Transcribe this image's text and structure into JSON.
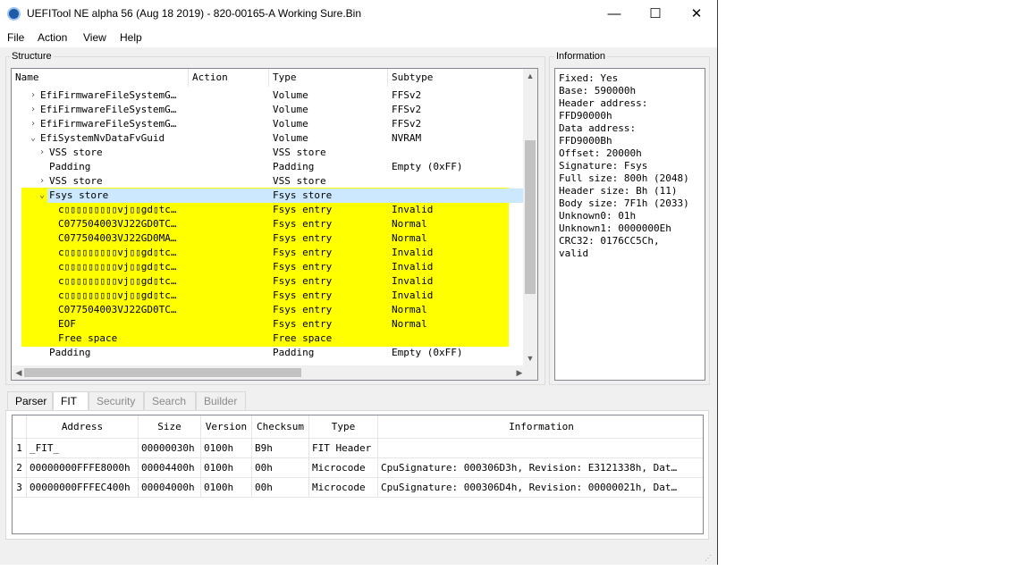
{
  "window": {
    "title": "UEFITool NE alpha 56 (Aug 18 2019) - 820-00165-A Working Sure.Bin",
    "minimize": "—",
    "maximize": "☐",
    "close": "✕"
  },
  "menu": [
    "File",
    "Action",
    "View",
    "Help"
  ],
  "structure": {
    "label": "Structure",
    "columns": [
      "Name",
      "Action",
      "Type",
      "Subtype"
    ],
    "rows": [
      {
        "indent": 1,
        "expander": "›",
        "name": "EfiFirmwareFileSystemG…",
        "action": "",
        "type": "Volume",
        "subtype": "FFSv2"
      },
      {
        "indent": 1,
        "expander": "›",
        "name": "EfiFirmwareFileSystemG…",
        "action": "",
        "type": "Volume",
        "subtype": "FFSv2"
      },
      {
        "indent": 1,
        "expander": "›",
        "name": "EfiFirmwareFileSystemG…",
        "action": "",
        "type": "Volume",
        "subtype": "FFSv2"
      },
      {
        "indent": 1,
        "expander": "⌄",
        "name": "EfiSystemNvDataFvGuid",
        "action": "",
        "type": "Volume",
        "subtype": "NVRAM"
      },
      {
        "indent": 2,
        "expander": "›",
        "name": "VSS store",
        "action": "",
        "type": "VSS store",
        "subtype": ""
      },
      {
        "indent": 2,
        "expander": "",
        "name": "Padding",
        "action": "",
        "type": "Padding",
        "subtype": "Empty (0xFF)"
      },
      {
        "indent": 2,
        "expander": "›",
        "name": "VSS store",
        "action": "",
        "type": "VSS store",
        "subtype": ""
      },
      {
        "indent": 2,
        "expander": "⌄",
        "name": "Fsys store",
        "action": "",
        "type": "Fsys store",
        "subtype": ""
      },
      {
        "indent": 3,
        "expander": "",
        "name": "c▯▯▯▯▯▯▯▯▯vj▯▯gd▯tc…",
        "action": "",
        "type": "Fsys entry",
        "subtype": "Invalid"
      },
      {
        "indent": 3,
        "expander": "",
        "name": "C077504003VJ22GD0TC…",
        "action": "",
        "type": "Fsys entry",
        "subtype": "Normal"
      },
      {
        "indent": 3,
        "expander": "",
        "name": "C077504003VJ22GD0MA…",
        "action": "",
        "type": "Fsys entry",
        "subtype": "Normal"
      },
      {
        "indent": 3,
        "expander": "",
        "name": "c▯▯▯▯▯▯▯▯▯vj▯▯gd▯tc…",
        "action": "",
        "type": "Fsys entry",
        "subtype": "Invalid"
      },
      {
        "indent": 3,
        "expander": "",
        "name": "c▯▯▯▯▯▯▯▯▯vj▯▯gd▯tc…",
        "action": "",
        "type": "Fsys entry",
        "subtype": "Invalid"
      },
      {
        "indent": 3,
        "expander": "",
        "name": "c▯▯▯▯▯▯▯▯▯vj▯▯gd▯tc…",
        "action": "",
        "type": "Fsys entry",
        "subtype": "Invalid"
      },
      {
        "indent": 3,
        "expander": "",
        "name": "c▯▯▯▯▯▯▯▯▯vj▯▯gd▯tc…",
        "action": "",
        "type": "Fsys entry",
        "subtype": "Invalid"
      },
      {
        "indent": 3,
        "expander": "",
        "name": "C077504003VJ22GD0TC…",
        "action": "",
        "type": "Fsys entry",
        "subtype": "Normal"
      },
      {
        "indent": 3,
        "expander": "",
        "name": "EOF",
        "action": "",
        "type": "Fsys entry",
        "subtype": "Normal"
      },
      {
        "indent": 3,
        "expander": "",
        "name": "Free space",
        "action": "",
        "type": "Free space",
        "subtype": ""
      },
      {
        "indent": 2,
        "expander": "",
        "name": "Padding",
        "action": "",
        "type": "Padding",
        "subtype": "Empty (0xFF)"
      }
    ],
    "highlight_color": "#ffff00",
    "selection_color": "#cce8ff"
  },
  "information": {
    "label": "Information",
    "lines": [
      "Fixed: Yes",
      "Base: 590000h",
      "Header address:",
      "FFD90000h",
      "Data address:",
      "FFD9000Bh",
      "Offset: 20000h",
      "Signature: Fsys",
      "Full size: 800h (2048)",
      "Header size: Bh (11)",
      "Body size: 7F1h (2033)",
      "Unknown0: 01h",
      "Unknown1: 0000000Eh",
      "CRC32: 0176CC5Ch,",
      "valid"
    ]
  },
  "tabs": [
    {
      "label": "Parser",
      "state": "normal"
    },
    {
      "label": "FIT",
      "state": "active"
    },
    {
      "label": "Security",
      "state": "disabled"
    },
    {
      "label": "Search",
      "state": "disabled"
    },
    {
      "label": "Builder",
      "state": "disabled"
    }
  ],
  "fit": {
    "columns": [
      "Address",
      "Size",
      "Version",
      "Checksum",
      "Type",
      "Information"
    ],
    "rows": [
      {
        "num": "1",
        "address": "_FIT_",
        "size": "00000030h",
        "version": "0100h",
        "checksum": "B9h",
        "type": "FIT Header",
        "information": ""
      },
      {
        "num": "2",
        "address": "00000000FFFE8000h",
        "size": "00004400h",
        "version": "0100h",
        "checksum": "00h",
        "type": "Microcode",
        "information": "CpuSignature: 000306D3h, Revision: E3121338h, Dat…"
      },
      {
        "num": "3",
        "address": "00000000FFFEC400h",
        "size": "00004000h",
        "version": "0100h",
        "checksum": "00h",
        "type": "Microcode",
        "information": "CpuSignature: 000306D4h, Revision: 00000021h, Dat…"
      }
    ]
  }
}
